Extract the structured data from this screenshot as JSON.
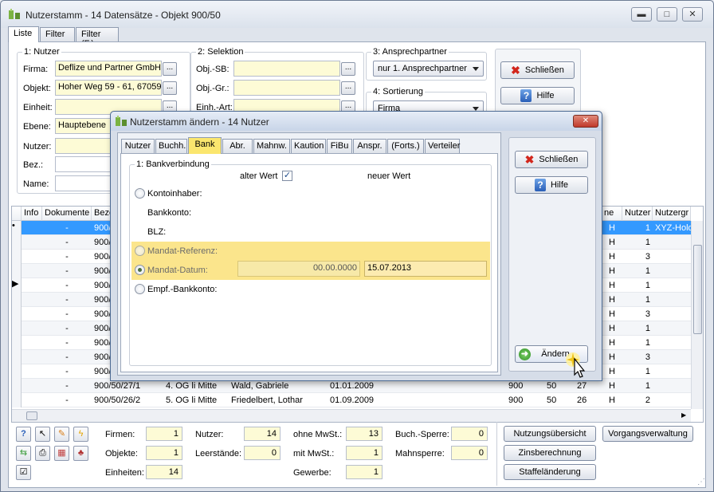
{
  "window": {
    "title": "Nutzerstamm - 14 Datensätze - Objekt 900/50"
  },
  "tabs": [
    "Liste",
    "Filter",
    "Filter (F.)"
  ],
  "nutzer": {
    "title": "1: Nutzer",
    "firma_label": "Firma:",
    "firma_value": "Deflize und Partner GmbH",
    "objekt_label": "Objekt:",
    "objekt_value": "Hoher Weg 59 - 61, 67059",
    "einheit_label": "Einheit:",
    "einheit_value": "",
    "ebene_label": "Ebene:",
    "ebene_value": "Hauptebene",
    "nutzer_label": "Nutzer:",
    "bez_label": "Bez.:",
    "name_label": "Name:",
    "dots": "..."
  },
  "selektion": {
    "title": "2: Selektion",
    "objsb_label": "Obj.-SB:",
    "objgr_label": "Obj.-Gr.:",
    "einhart_label": "Einh.-Art:"
  },
  "ansprech": {
    "title": "3: Ansprechpartner",
    "value": "nur 1. Ansprechpartner"
  },
  "sortierung": {
    "title": "4: Sortierung",
    "value": "Firma"
  },
  "main_buttons": {
    "close": "Schließen",
    "help": "Hilfe"
  },
  "grid": {
    "headers": [
      "Info",
      "Dokumente",
      "Beze",
      "ne",
      "Nutzer",
      "Nutzergr"
    ],
    "rows": [
      {
        "ind": "•",
        "dok": "-",
        "bez": "900/",
        "ne": "H",
        "nutzer": "1",
        "gr": "XYZ-Hold",
        "selected": true
      },
      {
        "ind": "",
        "dok": "-",
        "bez": "900/",
        "ne": "H",
        "nutzer": "1",
        "gr": ""
      },
      {
        "ind": "",
        "dok": "-",
        "bez": "900/",
        "ne": "H",
        "nutzer": "3",
        "gr": ""
      },
      {
        "ind": "",
        "dok": "-",
        "bez": "900/",
        "ne": "H",
        "nutzer": "1",
        "gr": ""
      },
      {
        "ind": "▶",
        "dok": "-",
        "bez": "900/",
        "ne": "H",
        "nutzer": "1",
        "gr": ""
      },
      {
        "ind": "",
        "dok": "-",
        "bez": "900/",
        "ne": "H",
        "nutzer": "1",
        "gr": ""
      },
      {
        "ind": "",
        "dok": "-",
        "bez": "900/",
        "ne": "H",
        "nutzer": "3",
        "gr": ""
      },
      {
        "ind": "",
        "dok": "-",
        "bez": "900/",
        "ne": "H",
        "nutzer": "1",
        "gr": ""
      },
      {
        "ind": "",
        "dok": "-",
        "bez": "900/",
        "ne": "H",
        "nutzer": "1",
        "gr": ""
      },
      {
        "ind": "",
        "dok": "-",
        "bez": "900/",
        "ne": "H",
        "nutzer": "3",
        "gr": ""
      },
      {
        "ind": "",
        "dok": "-",
        "bez": "900/",
        "ne": "H",
        "nutzer": "1",
        "gr": ""
      }
    ],
    "full_rows": [
      {
        "dok": "-",
        "bez": "900/50/27/1",
        "lage": "4. OG li Mitte",
        "name": "Wald, Gabriele",
        "datum": "01.01.2009",
        "a": "900",
        "b": "50",
        "c": "27",
        "ne": "H",
        "nutzer": "1"
      },
      {
        "dok": "-",
        "bez": "900/50/26/2",
        "lage": "5. OG li Mitte",
        "name": "Friedelbert, Lothar",
        "datum": "01.09.2009",
        "a": "900",
        "b": "50",
        "c": "26",
        "ne": "H",
        "nutzer": "2"
      }
    ]
  },
  "stats": {
    "firmen_label": "Firmen:",
    "firmen": "1",
    "objekte_label": "Objekte:",
    "objekte": "1",
    "einheiten_label": "Einheiten:",
    "einheiten": "14",
    "nutzer_label": "Nutzer:",
    "nutzer": "14",
    "leer_label": "Leerstände:",
    "leer": "0",
    "ohne_label": "ohne MwSt.:",
    "ohne": "13",
    "mit_label": "mit MwSt.:",
    "mit": "1",
    "gewerbe_label": "Gewerbe:",
    "gewerbe": "1",
    "buch_label": "Buch.-Sperre:",
    "buch": "0",
    "mahn_label": "Mahnsperre:",
    "mahn": "0"
  },
  "bottom_buttons": {
    "nutzungs": "Nutzungsübersicht",
    "vorgang": "Vorgangsverwaltung",
    "zins": "Zinsberechnung",
    "staffel": "Staffeländerung"
  },
  "dialog": {
    "title": "Nutzerstamm ändern - 14 Nutzer",
    "tabs": [
      "Nutzer",
      "Buchh.",
      "Bank",
      "Abr.",
      "Mahnw.",
      "Kaution",
      "FiBu",
      "Anspr.",
      "(Forts.)",
      "Verteiler"
    ],
    "group_title": "1: Bankverbindung",
    "alter_wert": "alter Wert",
    "neuer_wert": "neuer Wert",
    "kontoinhaber": "Kontoinhaber:",
    "bankkonto": "Bankkonto:",
    "blz": "BLZ:",
    "mandat_ref": "Mandat-Referenz:",
    "mandat_datum": "Mandat-Datum:",
    "mandat_alt": "00.00.0000",
    "mandat_neu": "15.07.2013",
    "empf": "Empf.-Bankkonto:",
    "close": "Schließen",
    "help": "Hilfe",
    "aendern": "Ändern",
    "close_x": "✕"
  }
}
